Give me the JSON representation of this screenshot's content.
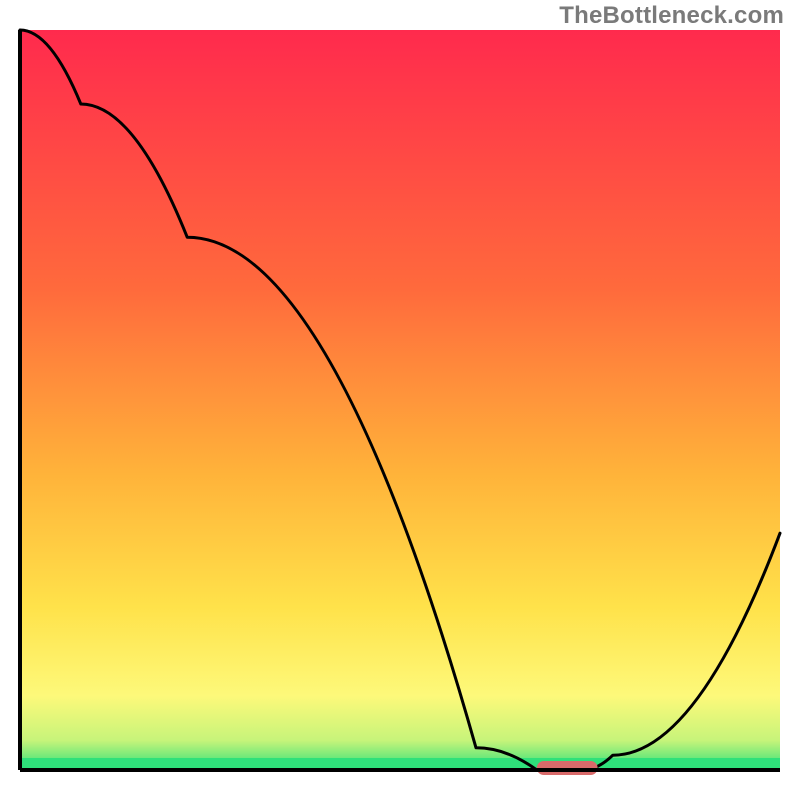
{
  "watermark": "TheBottleneck.com",
  "chart_data": {
    "type": "line",
    "title": "",
    "xlabel": "",
    "ylabel": "",
    "xlim": [
      0,
      100
    ],
    "ylim": [
      0,
      100
    ],
    "grid": false,
    "legend": false,
    "annotations": [],
    "series": [
      {
        "name": "bottleneck-curve",
        "color": "#000000",
        "x": [
          0,
          8,
          22,
          60,
          68,
          74,
          78,
          100
        ],
        "y": [
          100,
          90,
          72,
          3,
          0,
          0,
          2,
          32
        ]
      }
    ],
    "optimal_band": {
      "x_start": 68,
      "x_end": 76,
      "y": 0
    },
    "background_gradient": {
      "stops": [
        {
          "offset": 0,
          "color": "#ff2a4d"
        },
        {
          "offset": 35,
          "color": "#ff6a3c"
        },
        {
          "offset": 60,
          "color": "#ffb33a"
        },
        {
          "offset": 78,
          "color": "#ffe24a"
        },
        {
          "offset": 90,
          "color": "#fdf97a"
        },
        {
          "offset": 96,
          "color": "#c7f47a"
        },
        {
          "offset": 100,
          "color": "#2fe07a"
        }
      ]
    },
    "marker": {
      "color": "#d86a6a"
    }
  }
}
